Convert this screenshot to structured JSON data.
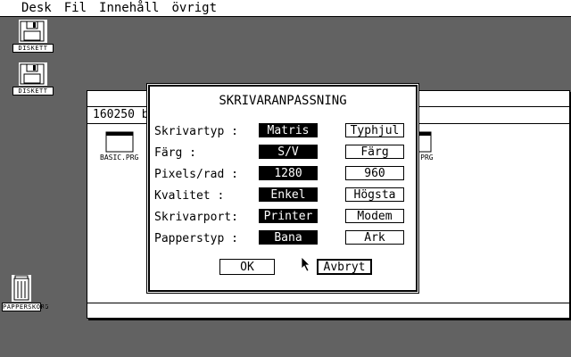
{
  "menubar": {
    "items": [
      "Desk",
      "Fil",
      "Innehåll",
      "övrigt"
    ]
  },
  "desktop": {
    "disk1_label": "DISKETT",
    "disk2_label": "DISKETT",
    "trash_label": "PAPPERSKORG"
  },
  "window": {
    "info": "160250 b",
    "files": [
      {
        "name": "BASIC.PRG"
      },
      {
        "name": ".PRG"
      }
    ]
  },
  "dialog": {
    "title": "SKRIVARANPASSNING",
    "rows": [
      {
        "label": "Skrivartyp :",
        "options": [
          "Matris",
          "Typhjul"
        ],
        "selected": 0
      },
      {
        "label": "Färg       :",
        "options": [
          "S/V",
          "Färg"
        ],
        "selected": 0
      },
      {
        "label": "Pixels/rad :",
        "options": [
          "1280",
          "960"
        ],
        "selected": 0
      },
      {
        "label": "Kvalitet   :",
        "options": [
          "Enkel",
          "Högsta"
        ],
        "selected": 0
      },
      {
        "label": "Skrivarport:",
        "options": [
          "Printer",
          "Modem"
        ],
        "selected": 0
      },
      {
        "label": "Papperstyp :",
        "options": [
          "Bana",
          "Ark"
        ],
        "selected": 0
      }
    ],
    "ok_label": "OK",
    "cancel_label": "Avbryt"
  }
}
